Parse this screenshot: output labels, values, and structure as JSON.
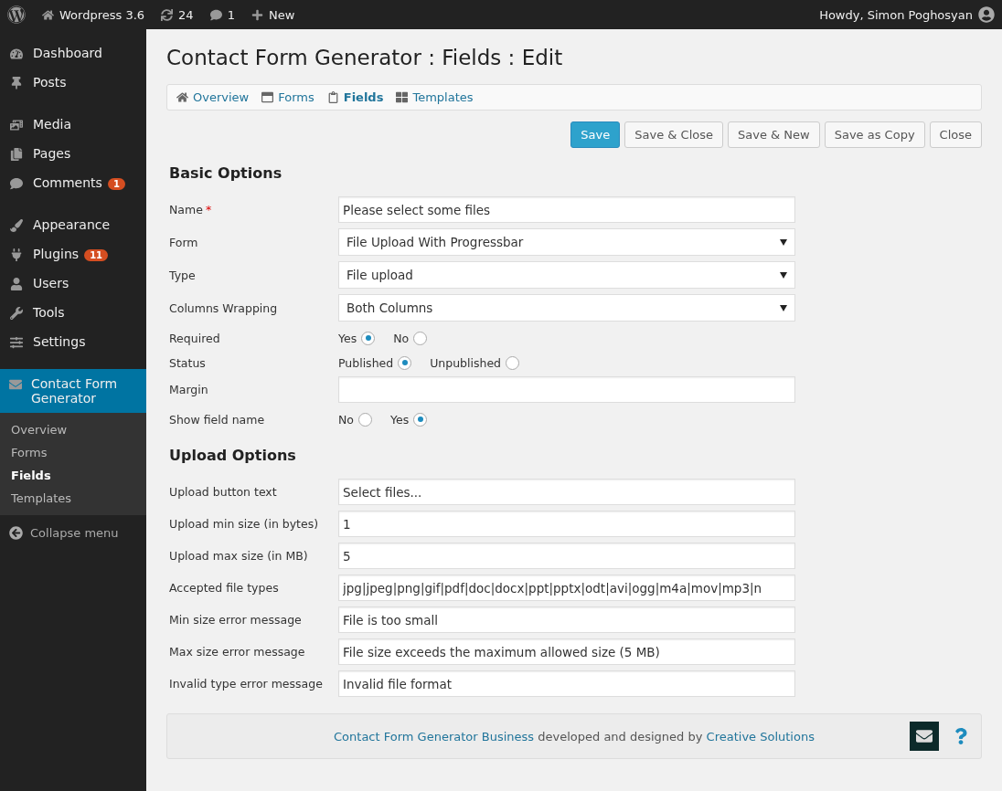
{
  "admin_bar": {
    "site": "Wordpress 3.6",
    "updates": "24",
    "comments": "1",
    "new": "New",
    "greeting": "Howdy, Simon Poghosyan"
  },
  "sidebar": {
    "items": [
      {
        "label": "Dashboard",
        "selected": false
      },
      {
        "label": "Posts",
        "selected": false
      },
      {
        "label": "Media",
        "selected": false
      },
      {
        "label": "Pages",
        "selected": false
      },
      {
        "label": "Comments",
        "selected": false,
        "badge": "1"
      },
      {
        "label": "Appearance",
        "selected": false
      },
      {
        "label": "Plugins",
        "selected": false,
        "badge": "11"
      },
      {
        "label": "Users",
        "selected": false
      },
      {
        "label": "Tools",
        "selected": false
      },
      {
        "label": "Settings",
        "selected": false
      },
      {
        "label": "Contact Form Generator",
        "selected": true
      }
    ],
    "submenu": [
      {
        "label": "Overview",
        "selected": false
      },
      {
        "label": "Forms",
        "selected": false
      },
      {
        "label": "Fields",
        "selected": true
      },
      {
        "label": "Templates",
        "selected": false
      }
    ],
    "collapse": "Collapse menu"
  },
  "page_title": "Contact Form Generator : Fields : Edit",
  "tabs": [
    {
      "label": "Overview",
      "selected": false
    },
    {
      "label": "Forms",
      "selected": false
    },
    {
      "label": "Fields",
      "selected": true
    },
    {
      "label": "Templates",
      "selected": false
    }
  ],
  "buttons": [
    {
      "label": "Save",
      "primary": true
    },
    {
      "label": "Save & Close",
      "primary": false
    },
    {
      "label": "Save & New",
      "primary": false
    },
    {
      "label": "Save as Copy",
      "primary": false
    },
    {
      "label": "Close",
      "primary": false
    }
  ],
  "sections": [
    {
      "title": "Basic Options",
      "rows": [
        {
          "label": "Name",
          "marker": "*",
          "kind": "text",
          "value": "Please select some files"
        },
        {
          "label": "Form",
          "kind": "select",
          "value": "File Upload With Progressbar"
        },
        {
          "label": "Type",
          "kind": "select",
          "value": "File upload"
        },
        {
          "label": "Columns Wrapping",
          "kind": "select",
          "value": "Both Columns"
        },
        {
          "label": "Required",
          "kind": "radio",
          "options": [
            {
              "label": "Yes",
              "selected": true
            },
            {
              "label": "No",
              "selected": false
            }
          ]
        },
        {
          "label": "Status",
          "kind": "radio",
          "options": [
            {
              "label": "Published",
              "selected": true
            },
            {
              "label": "Unpublished",
              "selected": false
            }
          ]
        },
        {
          "label": "Margin",
          "kind": "text",
          "value": ""
        },
        {
          "label": "Show field name",
          "kind": "radio",
          "options": [
            {
              "label": "No",
              "selected": false
            },
            {
              "label": "Yes",
              "selected": true
            }
          ]
        }
      ]
    },
    {
      "title": "Upload Options",
      "rows": [
        {
          "label": "Upload button text",
          "kind": "text",
          "value": "Select files..."
        },
        {
          "label": "Upload min size (in bytes)",
          "kind": "text",
          "value": "1"
        },
        {
          "label": "Upload max size (in MB)",
          "kind": "text",
          "value": "5"
        },
        {
          "label": "Accepted file types",
          "kind": "text",
          "value": "jpg|jpeg|png|gif|pdf|doc|docx|ppt|pptx|odt|avi|ogg|m4a|mov|mp3|n"
        },
        {
          "label": "Min size error message",
          "kind": "text",
          "value": "File is too small"
        },
        {
          "label": "Max size error message",
          "kind": "text",
          "value": "File size exceeds the maximum allowed size (5 MB)"
        },
        {
          "label": "Invalid type error message",
          "kind": "text",
          "value": "Invalid file format"
        }
      ]
    }
  ],
  "footer": {
    "product": "Contact Form Generator Business",
    "text": "developed and designed by",
    "author": "Creative Solutions"
  }
}
